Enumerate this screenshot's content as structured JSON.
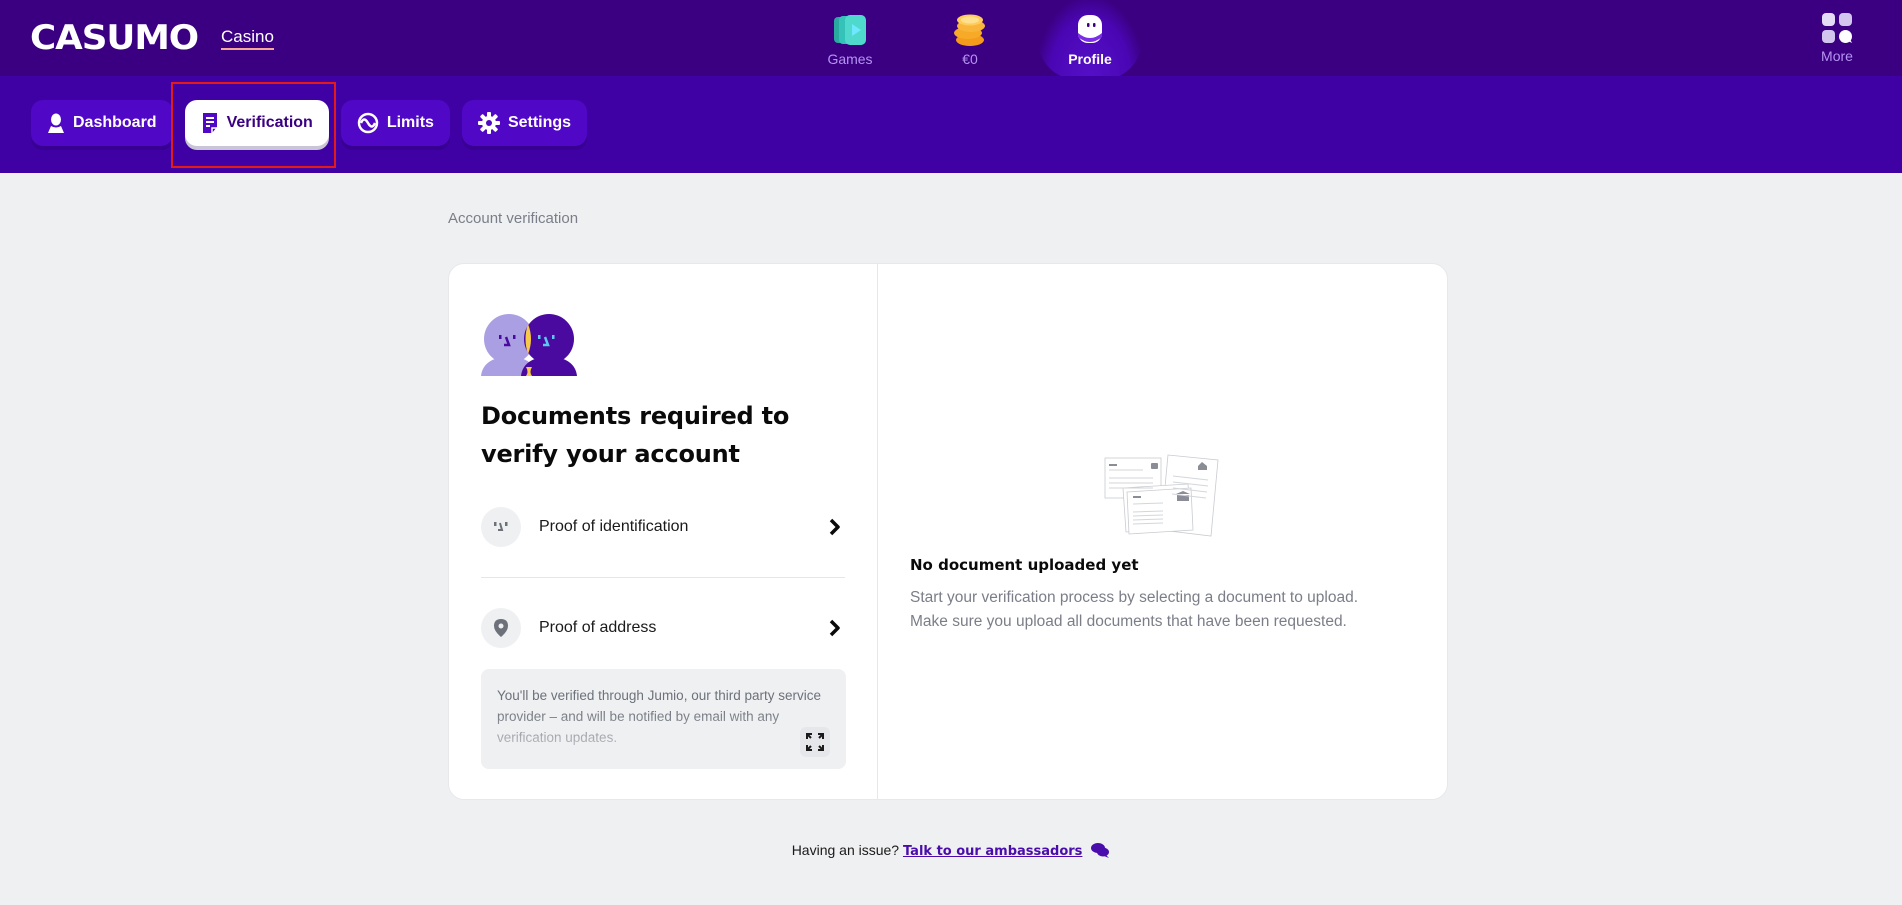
{
  "header": {
    "logo": "CASUMO",
    "section_link": "Casino",
    "nav": [
      {
        "label": "Games",
        "icon": "games-icon"
      },
      {
        "label": "€0",
        "icon": "coins-icon"
      },
      {
        "label": "Profile",
        "icon": "profile-icon",
        "active": true
      }
    ],
    "more_label": "More"
  },
  "tabs": [
    {
      "label": "Dashboard",
      "icon": "user-icon"
    },
    {
      "label": "Verification",
      "icon": "document-icon",
      "active": true
    },
    {
      "label": "Limits",
      "icon": "limits-icon"
    },
    {
      "label": "Settings",
      "icon": "gear-icon"
    }
  ],
  "page": {
    "heading": "Account verification",
    "card_title": "Documents required to verify your account",
    "documents": [
      {
        "label": "Proof of identification",
        "icon": "face-icon"
      },
      {
        "label": "Proof of address",
        "icon": "location-pin-icon"
      }
    ],
    "info_text": "You'll be verified through Jumio, our third party service provider – and will be notified by email with any verification updates.",
    "empty_title": "No document uploaded yet",
    "empty_desc_1": "Start your verification process by selecting a document to upload.",
    "empty_desc_2": "Make sure you upload all documents that have been requested."
  },
  "footer": {
    "prompt": "Having an issue?",
    "link": "Talk to our ambassadors"
  },
  "colors": {
    "brand_dark": "#3b0082",
    "brand": "#5007c6",
    "accent_underline": "#f4a89a",
    "highlight": "#e41a1a"
  }
}
